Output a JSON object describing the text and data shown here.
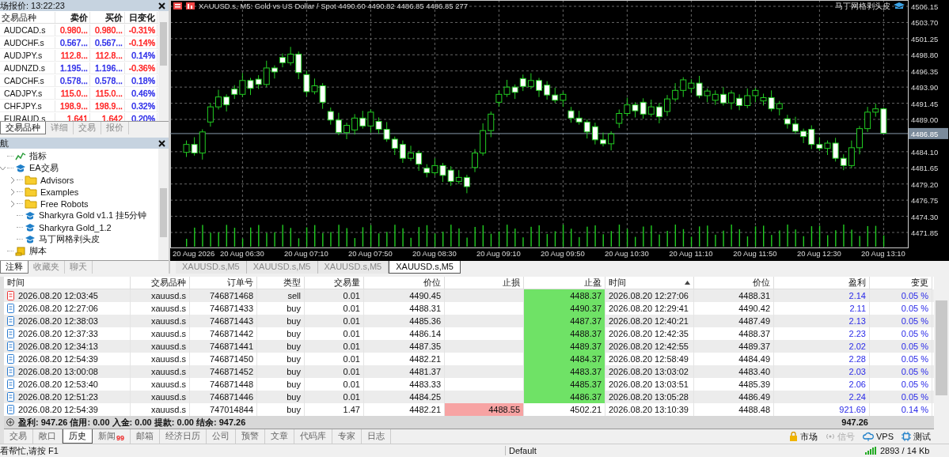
{
  "market_watch": {
    "title": "场报价: 13:22:23",
    "columns": [
      "交易品种",
      "卖价",
      "买价",
      "日变化"
    ],
    "rows": [
      {
        "symbol": "AUDCAD.s",
        "quotes": [
          {
            "text": "0.980...",
            "color": "#ff2020"
          },
          {
            "text": "0.980...",
            "color": "#ff2020"
          },
          {
            "text": "-0.31%",
            "color": "#ff2020"
          }
        ]
      },
      {
        "symbol": "AUDCHF.s",
        "quotes": [
          {
            "text": "0.567...",
            "color": "#2a2ae8"
          },
          {
            "text": "0.567...",
            "color": "#2a2ae8"
          },
          {
            "text": "-0.14%",
            "color": "#ff2020"
          }
        ]
      },
      {
        "symbol": "AUDJPY.s",
        "quotes": [
          {
            "text": "112.8...",
            "color": "#ff2020"
          },
          {
            "text": "112.8...",
            "color": "#ff2020"
          },
          {
            "text": "0.14%",
            "color": "#2a2ae8"
          }
        ]
      },
      {
        "symbol": "AUDNZD.s",
        "quotes": [
          {
            "text": "1.195...",
            "color": "#2a2ae8"
          },
          {
            "text": "1.196...",
            "color": "#2a2ae8"
          },
          {
            "text": "-0.36%",
            "color": "#ff2020"
          }
        ]
      },
      {
        "symbol": "CADCHF.s",
        "quotes": [
          {
            "text": "0.578...",
            "color": "#2a2ae8"
          },
          {
            "text": "0.578...",
            "color": "#2a2ae8"
          },
          {
            "text": "0.18%",
            "color": "#2a2ae8"
          }
        ]
      },
      {
        "symbol": "CADJPY.s",
        "quotes": [
          {
            "text": "115.0...",
            "color": "#ff2020"
          },
          {
            "text": "115.0...",
            "color": "#ff2020"
          },
          {
            "text": "0.46%",
            "color": "#2a2ae8"
          }
        ]
      },
      {
        "symbol": "CHFJPY.s",
        "quotes": [
          {
            "text": "198.9...",
            "color": "#ff2020"
          },
          {
            "text": "198.9...",
            "color": "#ff2020"
          },
          {
            "text": "0.32%",
            "color": "#2a2ae8"
          }
        ]
      },
      {
        "symbol": "EURAUD.s",
        "quotes": [
          {
            "text": "1.641",
            "color": "#ff2020"
          },
          {
            "text": "1.642",
            "color": "#ff2020"
          },
          {
            "text": "0.20%",
            "color": "#2a2ae8"
          }
        ]
      }
    ],
    "tabs": [
      {
        "label": "交易品种",
        "selected": true
      },
      {
        "label": "详细",
        "selected": false
      },
      {
        "label": "交易",
        "selected": false
      },
      {
        "label": "报价",
        "selected": false
      }
    ]
  },
  "navigator": {
    "title": "航",
    "tree": [
      {
        "label": "指标",
        "kind": "indicator"
      },
      {
        "label": "EA交易",
        "kind": "experts",
        "expanded": true,
        "children": [
          {
            "label": "Advisors",
            "kind": "folder",
            "expanded": false
          },
          {
            "label": "Examples",
            "kind": "folder",
            "expanded": false
          },
          {
            "label": "Free Robots",
            "kind": "folder",
            "expanded": false
          },
          {
            "label": "Sharkyra Gold v1.1 挂5分钟",
            "kind": "expert"
          },
          {
            "label": "Sharkyra Gold_1.2",
            "kind": "expert"
          },
          {
            "label": "马丁网格剥头皮",
            "kind": "expert"
          }
        ]
      },
      {
        "label": "脚本",
        "kind": "script"
      }
    ],
    "tabs": [
      {
        "label": "注释",
        "selected": true
      },
      {
        "label": "收藏夹",
        "selected": false
      },
      {
        "label": "聊天",
        "selected": false
      }
    ]
  },
  "chart": {
    "header": "XAUUSD.s, M5:  Gold vs US Dollar / Spot  4490.60 4490.82 4486.85 4486.85  277",
    "expert": "马丁网格剥头皮",
    "date_label": "20 Aug 2026",
    "chart_data": {
      "type": "candlestick",
      "grid": true,
      "ylim": [
        4469.57,
        4507.11
      ],
      "ref_lines": [
        {
          "axis": "y",
          "value": 4486.85,
          "label": "4486.85"
        }
      ],
      "categories": [
        null,
        null,
        null,
        null,
        null,
        null,
        null,
        "20 Aug 06:30",
        null,
        null,
        null,
        null,
        null,
        null,
        null,
        "20 Aug 07:10",
        null,
        null,
        null,
        null,
        null,
        null,
        null,
        "20 Aug 07:50",
        null,
        null,
        null,
        null,
        null,
        null,
        null,
        "20 Aug 08:30",
        null,
        null,
        null,
        null,
        null,
        null,
        null,
        "20 Aug 09:10",
        null,
        null,
        null,
        null,
        null,
        null,
        null,
        "20 Aug 09:50",
        null,
        null,
        null,
        null,
        null,
        null,
        null,
        "20 Aug 10:30",
        null,
        null,
        null,
        null,
        null,
        null,
        null,
        "20 Aug 11:10",
        null,
        null,
        null,
        null,
        null,
        null,
        null,
        "20 Aug 11:50",
        null,
        null,
        null,
        null,
        null,
        null,
        null,
        "20 Aug 12:30",
        null,
        null,
        null,
        null,
        null,
        null,
        null,
        "20 Aug 13:10"
      ],
      "yticks": [
        {
          "value": 4506.15,
          "label": "4506.15"
        },
        {
          "value": 4503.7,
          "label": "4503.70"
        },
        {
          "value": 4501.25,
          "label": "4501.25"
        },
        {
          "value": 4498.8,
          "label": "4498.80"
        },
        {
          "value": 4496.35,
          "label": "4496.35"
        },
        {
          "value": 4493.9,
          "label": "4493.90"
        },
        {
          "value": 4491.45,
          "label": "4491.45"
        },
        {
          "value": 4489,
          "label": "4489.00"
        },
        {
          "value": 4484.1,
          "label": "4484.10"
        },
        {
          "value": 4481.65,
          "label": "4481.65"
        },
        {
          "value": 4479.2,
          "label": "4479.20"
        },
        {
          "value": 4476.75,
          "label": "4476.75"
        },
        {
          "value": 4474.3,
          "label": "4474.30"
        },
        {
          "value": 4471.85,
          "label": "4471.85"
        }
      ],
      "ohlc": [
        [
          4484.0,
          4485.8,
          4483.3,
          4485.2
        ],
        [
          4485.2,
          4486.3,
          4483.5,
          4483.9
        ],
        [
          4483.9,
          4487.5,
          4482.9,
          4487.1
        ],
        [
          4488.6,
          4491.5,
          4487.9,
          4490.9
        ],
        [
          4490.9,
          4493.5,
          4490.5,
          4492.4
        ],
        [
          4492.4,
          4492.8,
          4490.2,
          4491.2
        ],
        [
          4493.6,
          4494.2,
          4492.1,
          4492.8
        ],
        [
          4492.8,
          4496.0,
          4492.4,
          4494.9
        ],
        [
          4494.9,
          4495.3,
          4492.7,
          4493.7
        ],
        [
          4495.1,
          4495.7,
          4493.6,
          4494.3
        ],
        [
          4494.3,
          4497.9,
          4493.9,
          4496.8
        ],
        [
          4496.8,
          4497.2,
          4495.2,
          4496.2
        ],
        [
          4498.4,
          4499.0,
          4496.9,
          4497.6
        ],
        [
          4497.6,
          4500.0,
          4497.2,
          4498.9
        ],
        [
          4498.9,
          4499.3,
          4495.1,
          4496.1
        ],
        [
          4495.8,
          4496.4,
          4492.5,
          4493.2
        ],
        [
          4493.2,
          4495.2,
          4492.8,
          4494.1
        ],
        [
          4494.1,
          4494.5,
          4490.6,
          4491.6
        ],
        [
          4490.2,
          4490.8,
          4488.2,
          4488.9
        ],
        [
          4488.9,
          4490.0,
          4486.6,
          4487.0
        ],
        [
          4487.0,
          4488.5,
          4486.0,
          4488.1
        ],
        [
          4487.4,
          4489.8,
          4486.7,
          4489.2
        ],
        [
          4489.2,
          4490.3,
          4487.6,
          4488.0
        ],
        [
          4488.0,
          4490.5,
          4487.0,
          4490.1
        ],
        [
          4488.7,
          4489.3,
          4486.8,
          4487.5
        ],
        [
          4487.5,
          4488.6,
          4485.6,
          4486.0
        ],
        [
          4486.0,
          4486.4,
          4483.6,
          4484.6
        ],
        [
          4485.2,
          4485.8,
          4482.4,
          4483.1
        ],
        [
          4483.1,
          4485.0,
          4482.7,
          4483.9
        ],
        [
          4483.9,
          4484.3,
          4481.2,
          4482.2
        ],
        [
          4481.6,
          4482.2,
          4480.2,
          4480.9
        ],
        [
          4480.9,
          4483.1,
          4480.5,
          4482.0
        ],
        [
          4482.0,
          4482.4,
          4479.5,
          4480.5
        ],
        [
          4481.3,
          4481.9,
          4478.9,
          4479.6
        ],
        [
          4479.6,
          4481.3,
          4479.2,
          4480.2
        ],
        [
          4480.2,
          4480.6,
          4477.8,
          4478.8
        ],
        [
          4481.7,
          4484.5,
          4481.0,
          4483.9
        ],
        [
          4483.9,
          4488.4,
          4483.5,
          4487.3
        ],
        [
          4487.3,
          4490.2,
          4486.3,
          4489.8
        ],
        [
          4491.6,
          4493.4,
          4490.9,
          4492.8
        ],
        [
          4492.8,
          4495.0,
          4492.4,
          4493.9
        ],
        [
          4493.9,
          4494.3,
          4492.1,
          4493.1
        ],
        [
          4495.2,
          4495.8,
          4493.3,
          4494.0
        ],
        [
          4494.0,
          4496.0,
          4493.6,
          4494.9
        ],
        [
          4494.9,
          4495.3,
          4492.4,
          4493.4
        ],
        [
          4494.2,
          4494.8,
          4492.0,
          4492.7
        ],
        [
          4492.7,
          4493.8,
          4491.5,
          4491.9
        ],
        [
          4491.9,
          4493.2,
          4490.9,
          4492.8
        ],
        [
          4490.3,
          4490.9,
          4488.5,
          4489.2
        ],
        [
          4489.2,
          4490.3,
          4488.2,
          4488.6
        ],
        [
          4488.6,
          4489.0,
          4486.1,
          4487.1
        ],
        [
          4487.9,
          4488.5,
          4485.2,
          4485.9
        ],
        [
          4485.9,
          4487.0,
          4484.9,
          4485.3
        ],
        [
          4485.3,
          4487.2,
          4484.3,
          4486.8
        ],
        [
          4488.4,
          4490.5,
          4487.7,
          4489.9
        ],
        [
          4489.9,
          4492.3,
          4489.5,
          4491.2
        ],
        [
          4491.2,
          4491.6,
          4489.3,
          4490.3
        ],
        [
          4491.6,
          4492.2,
          4489.1,
          4489.8
        ],
        [
          4489.8,
          4492.0,
          4489.4,
          4490.9
        ],
        [
          4490.9,
          4491.5,
          4488.4,
          4489.4
        ],
        [
          4490.2,
          4492.7,
          4489.5,
          4492.1
        ],
        [
          4492.1,
          4494.5,
          4491.7,
          4493.4
        ],
        [
          4493.4,
          4495.4,
          4492.4,
          4495.0
        ],
        [
          4493.7,
          4495.1,
          4493.0,
          4494.5
        ],
        [
          4494.5,
          4495.6,
          4492.2,
          4492.6
        ],
        [
          4492.6,
          4493.7,
          4491.6,
          4493.3
        ],
        [
          4491.9,
          4493.4,
          4491.2,
          4492.8
        ],
        [
          4492.8,
          4493.9,
          4491.1,
          4491.5
        ],
        [
          4491.5,
          4493.4,
          4490.5,
          4493.0
        ],
        [
          4492.2,
          4492.8,
          4490.4,
          4491.1
        ],
        [
          4491.1,
          4493.7,
          4490.7,
          4492.6
        ],
        [
          4492.6,
          4493.8,
          4491.6,
          4493.4
        ],
        [
          4491.8,
          4492.9,
          4491.1,
          4492.3
        ],
        [
          4492.3,
          4493.4,
          4490.2,
          4490.6
        ],
        [
          4490.6,
          4491.8,
          4489.6,
          4491.4
        ],
        [
          4489.1,
          4489.7,
          4487.6,
          4488.3
        ],
        [
          4488.3,
          4489.4,
          4486.8,
          4487.2
        ],
        [
          4487.2,
          4487.6,
          4485.4,
          4486.4
        ],
        [
          4487.5,
          4488.1,
          4484.5,
          4485.2
        ],
        [
          4485.2,
          4486.3,
          4484.2,
          4484.6
        ],
        [
          4484.6,
          4485.8,
          4483.6,
          4485.4
        ],
        [
          4485.4,
          4486.2,
          4482.6,
          4483.1
        ],
        [
          4483.1,
          4483.7,
          4481.3,
          4482.0
        ],
        [
          4482.0,
          4485.8,
          4481.6,
          4484.7
        ],
        [
          4484.7,
          4488.0,
          4483.7,
          4487.6
        ],
        [
          4487.6,
          4490.9,
          4487.1,
          4490.1
        ],
        [
          4490.1,
          4491.4,
          4489.4,
          4490.6
        ],
        [
          4490.6,
          4490.8,
          4486.9,
          4486.9
        ]
      ]
    },
    "tabs": [
      {
        "label": "XAUUSD.s,M5",
        "selected": false
      },
      {
        "label": "XAUUSD.s,M5",
        "selected": false
      },
      {
        "label": "XAUUSD.s,M5",
        "selected": false
      },
      {
        "label": "XAUUSD.s,M5",
        "selected": true
      }
    ]
  },
  "history": {
    "columns": [
      {
        "label": "时间",
        "sorted": false
      },
      {
        "label": "交易品种",
        "sorted": false
      },
      {
        "label": "订单号",
        "sorted": false
      },
      {
        "label": "类型",
        "sorted": false
      },
      {
        "label": "交易量",
        "sorted": false
      },
      {
        "label": "价位",
        "sorted": false
      },
      {
        "label": "止损",
        "sorted": false
      },
      {
        "label": "止盈",
        "sorted": false
      },
      {
        "label": "时间",
        "sorted": true
      },
      {
        "label": "价位",
        "sorted": false
      },
      {
        "label": "盈利",
        "sorted": false
      },
      {
        "label": "变更",
        "sorted": false
      }
    ],
    "rows": [
      {
        "kind": "sell",
        "time": "2026.08.20 12:03:45",
        "symbol": "xauusd.s",
        "ticket": "746871468",
        "type": "sell",
        "volume": "0.01",
        "price": "4490.45",
        "sl": "",
        "tp": "4488.37",
        "sl_hit": false,
        "tp_hit": true,
        "close_time": "2026.08.20 12:27:06",
        "close_price": "4488.31",
        "profit": "2.14",
        "change": "0.05 %"
      },
      {
        "kind": "buy",
        "time": "2026.08.20 12:27:06",
        "symbol": "xauusd.s",
        "ticket": "746871433",
        "type": "buy",
        "volume": "0.01",
        "price": "4488.31",
        "sl": "",
        "tp": "4490.37",
        "sl_hit": false,
        "tp_hit": true,
        "close_time": "2026.08.20 12:29:41",
        "close_price": "4490.42",
        "profit": "2.11",
        "change": "0.05 %"
      },
      {
        "kind": "buy",
        "time": "2026.08.20 12:38:03",
        "symbol": "xauusd.s",
        "ticket": "746871443",
        "type": "buy",
        "volume": "0.01",
        "price": "4485.36",
        "sl": "",
        "tp": "4487.37",
        "sl_hit": false,
        "tp_hit": true,
        "close_time": "2026.08.20 12:40:21",
        "close_price": "4487.49",
        "profit": "2.13",
        "change": "0.05 %"
      },
      {
        "kind": "buy",
        "time": "2026.08.20 12:37:33",
        "symbol": "xauusd.s",
        "ticket": "746871442",
        "type": "buy",
        "volume": "0.01",
        "price": "4486.14",
        "sl": "",
        "tp": "4488.37",
        "sl_hit": false,
        "tp_hit": true,
        "close_time": "2026.08.20 12:42:35",
        "close_price": "4488.37",
        "profit": "2.23",
        "change": "0.05 %"
      },
      {
        "kind": "buy",
        "time": "2026.08.20 12:34:13",
        "symbol": "xauusd.s",
        "ticket": "746871441",
        "type": "buy",
        "volume": "0.01",
        "price": "4487.35",
        "sl": "",
        "tp": "4489.37",
        "sl_hit": false,
        "tp_hit": true,
        "close_time": "2026.08.20 12:42:55",
        "close_price": "4489.37",
        "profit": "2.02",
        "change": "0.05 %"
      },
      {
        "kind": "buy",
        "time": "2026.08.20 12:54:39",
        "symbol": "xauusd.s",
        "ticket": "746871450",
        "type": "buy",
        "volume": "0.01",
        "price": "4482.21",
        "sl": "",
        "tp": "4484.37",
        "sl_hit": false,
        "tp_hit": true,
        "close_time": "2026.08.20 12:58:49",
        "close_price": "4484.49",
        "profit": "2.28",
        "change": "0.05 %"
      },
      {
        "kind": "buy",
        "time": "2026.08.20 13:00:08",
        "symbol": "xauusd.s",
        "ticket": "746871452",
        "type": "buy",
        "volume": "0.01",
        "price": "4481.37",
        "sl": "",
        "tp": "4483.37",
        "sl_hit": false,
        "tp_hit": true,
        "close_time": "2026.08.20 13:03:02",
        "close_price": "4483.40",
        "profit": "2.03",
        "change": "0.05 %"
      },
      {
        "kind": "buy",
        "time": "2026.08.20 12:53:40",
        "symbol": "xauusd.s",
        "ticket": "746871448",
        "type": "buy",
        "volume": "0.01",
        "price": "4483.33",
        "sl": "",
        "tp": "4485.37",
        "sl_hit": false,
        "tp_hit": true,
        "close_time": "2026.08.20 13:03:51",
        "close_price": "4485.39",
        "profit": "2.06",
        "change": "0.05 %"
      },
      {
        "kind": "buy",
        "time": "2026.08.20 12:51:23",
        "symbol": "xauusd.s",
        "ticket": "746871446",
        "type": "buy",
        "volume": "0.01",
        "price": "4484.25",
        "sl": "",
        "tp": "4486.37",
        "sl_hit": false,
        "tp_hit": true,
        "close_time": "2026.08.20 13:05:28",
        "close_price": "4486.49",
        "profit": "2.24",
        "change": "0.05 %"
      },
      {
        "kind": "buy",
        "time": "2026.08.20 12:54:39",
        "symbol": "xauusd.s",
        "ticket": "747014844",
        "type": "buy",
        "volume": "1.47",
        "price": "4482.21",
        "sl": "4488.55",
        "tp": "4502.21",
        "sl_hit": true,
        "tp_hit": false,
        "close_time": "2026.08.20 13:10:39",
        "close_price": "4488.48",
        "profit": "921.69",
        "change": "0.14 %"
      }
    ],
    "summary": {
      "text": "盈利: 947.26 信用: 0.00 入金: 0.00 提款: 0.00 结余: 947.26",
      "profit": "947.26"
    }
  },
  "terminal_tabs": [
    {
      "label": "交易",
      "selected": false
    },
    {
      "label": "敞口",
      "selected": false
    },
    {
      "label": "历史",
      "selected": true
    },
    {
      "label": "新闻",
      "selected": false,
      "badge": "99"
    },
    {
      "label": "邮箱",
      "selected": false
    },
    {
      "label": "经济日历",
      "selected": false
    },
    {
      "label": "公司",
      "selected": false
    },
    {
      "label": "预警",
      "selected": false
    },
    {
      "label": "文章",
      "selected": false
    },
    {
      "label": "代码库",
      "selected": false
    },
    {
      "label": "专家",
      "selected": false
    },
    {
      "label": "日志",
      "selected": false
    }
  ],
  "tools": [
    {
      "label": "市场",
      "kind": "market",
      "disabled": false
    },
    {
      "label": "信号",
      "kind": "signals",
      "disabled": true
    },
    {
      "label": "VPS",
      "kind": "vps",
      "disabled": false
    },
    {
      "label": "测试",
      "kind": "tester",
      "disabled": false
    }
  ],
  "status_bar": {
    "help": "看帮忙,请按 F1",
    "profile": "Default",
    "traffic": "2893 / 14 Kb"
  }
}
